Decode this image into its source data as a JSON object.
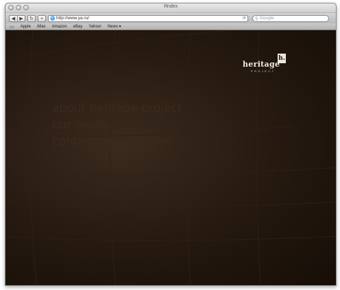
{
  "window": {
    "title": "Яndex"
  },
  "toolbar": {
    "back_glyph": "◀",
    "forward_glyph": "▶",
    "reload_glyph": "↻",
    "add_glyph": "+",
    "url": "http://www.ya.ru/",
    "search_placeholder": "Google"
  },
  "bookmarks": {
    "items": [
      "Apple",
      "iMac",
      "Amazon",
      "eBay",
      "Yahoo!",
      "News ▾"
    ]
  },
  "page": {
    "logo": {
      "word": "heritage",
      "mark": "h.",
      "sub": "PROJECT"
    },
    "nav": [
      "about heritage project",
      "our works",
      "contacts information"
    ]
  },
  "colors": {
    "background": "#1b120b",
    "nav_text": "#3b2a1b",
    "logo_text": "#f3eee6"
  }
}
